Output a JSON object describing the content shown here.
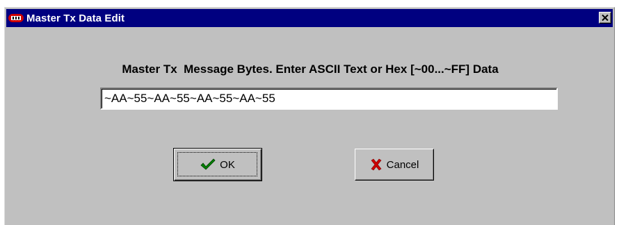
{
  "window": {
    "title": "Master Tx Data Edit"
  },
  "dialog": {
    "prompt": "Master Tx  Message Bytes. Enter ASCII Text or Hex [~00...~FF] Data",
    "data_value": "~AA~55~AA~55~AA~55~AA~55"
  },
  "buttons": {
    "ok_label": "OK",
    "cancel_label": "Cancel"
  },
  "icons": {
    "app": "app-logo-icon",
    "close": "close-icon",
    "ok": "checkmark-icon",
    "cancel": "red-x-icon"
  },
  "colors": {
    "titlebar": "#000080",
    "dialog_bg": "#c0c0c0",
    "check": "#008000",
    "x_mark": "#cc0000"
  }
}
